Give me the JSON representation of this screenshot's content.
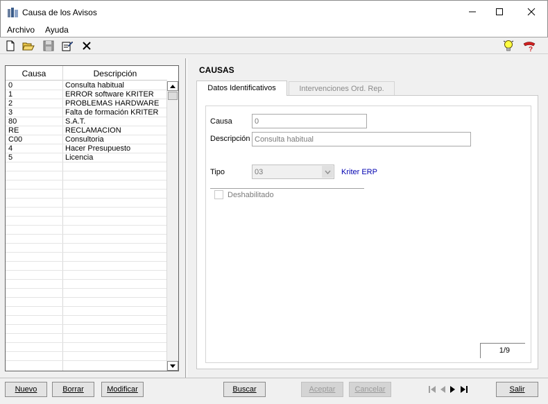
{
  "window": {
    "title": "Causa de los Avisos"
  },
  "menu": {
    "items": [
      "Archivo",
      "Ayuda"
    ]
  },
  "toolbar": {
    "icons": [
      "new-icon",
      "open-icon",
      "save-icon",
      "edit-icon",
      "delete-icon",
      "tip-icon",
      "help-icon"
    ]
  },
  "grid": {
    "headers": {
      "causa": "Causa",
      "descripcion": "Descripción"
    },
    "rows": [
      {
        "causa": "0",
        "descripcion": "Consulta habitual"
      },
      {
        "causa": "1",
        "descripcion": "ERROR software KRITER"
      },
      {
        "causa": "2",
        "descripcion": "PROBLEMAS HARDWARE"
      },
      {
        "causa": "3",
        "descripcion": "Falta de formación KRITER"
      },
      {
        "causa": "80",
        "descripcion": "S.A.T."
      },
      {
        "causa": "RE",
        "descripcion": "RECLAMACION"
      },
      {
        "causa": "C00",
        "descripcion": "Consultoria"
      },
      {
        "causa": "4",
        "descripcion": "Hacer Presupuesto"
      },
      {
        "causa": "5",
        "descripcion": "Licencia"
      }
    ]
  },
  "detail": {
    "section_title": "CAUSAS",
    "tabs": {
      "active": "Datos Identificativos",
      "inactive": "Intervenciones Ord. Rep."
    },
    "causa_label": "Causa",
    "causa_value": "0",
    "descripcion_label": "Descripción",
    "descripcion_value": "Consulta habitual",
    "tipo_label": "Tipo",
    "tipo_value": "03",
    "tipo_desc": "Kriter ERP",
    "deshabilitado_label": "Deshabilitado",
    "record_counter": "1/9"
  },
  "buttons": {
    "nuevo": "Nuevo",
    "borrar": "Borrar",
    "modificar": "Modificar",
    "buscar": "Buscar",
    "aceptar": "Aceptar",
    "cancelar": "Cancelar",
    "salir": "Salir"
  }
}
